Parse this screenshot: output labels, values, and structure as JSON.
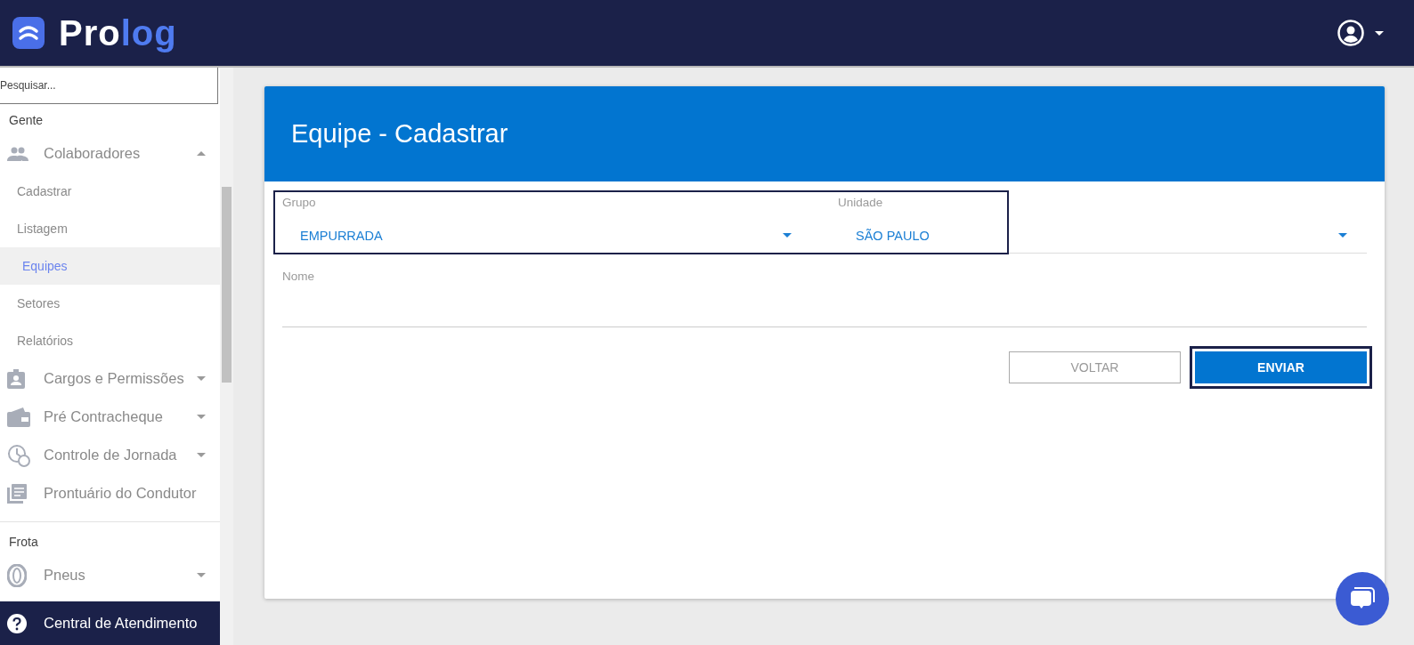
{
  "logo": {
    "parts": [
      "Pro",
      "log"
    ]
  },
  "sidebar": {
    "search": {
      "placeholder": "Pesquisar..."
    },
    "sections": [
      {
        "title": "Gente",
        "items": [
          {
            "label": "Colaboradores",
            "expanded": true,
            "children": [
              {
                "label": "Cadastrar",
                "selected": false
              },
              {
                "label": "Listagem",
                "selected": false
              },
              {
                "label": "Equipes",
                "selected": true
              },
              {
                "label": "Setores",
                "selected": false
              },
              {
                "label": "Relatórios",
                "selected": false
              }
            ]
          },
          {
            "label": "Cargos e Permissões",
            "expanded": false
          },
          {
            "label": "Pré Contracheque",
            "expanded": false
          },
          {
            "label": "Controle de Jornada",
            "expanded": false
          },
          {
            "label": "Prontuário do Condutor"
          }
        ]
      },
      {
        "title": "Frota",
        "items": [
          {
            "label": "Pneus",
            "expanded": false
          }
        ]
      }
    ],
    "footer": "Central de Atendimento"
  },
  "card": {
    "title": "Equipe - Cadastrar",
    "selects": [
      {
        "label": "Grupo",
        "value": "EMPURRADA"
      },
      {
        "label": "Unidade",
        "value": "SÃO PAULO"
      }
    ],
    "name_field": {
      "label": "Nome"
    },
    "buttons": [
      {
        "label": "VOLTAR",
        "kind": "secondary",
        "focused": false
      },
      {
        "label": "ENVIAR",
        "kind": "primary",
        "focused": true
      }
    ]
  }
}
